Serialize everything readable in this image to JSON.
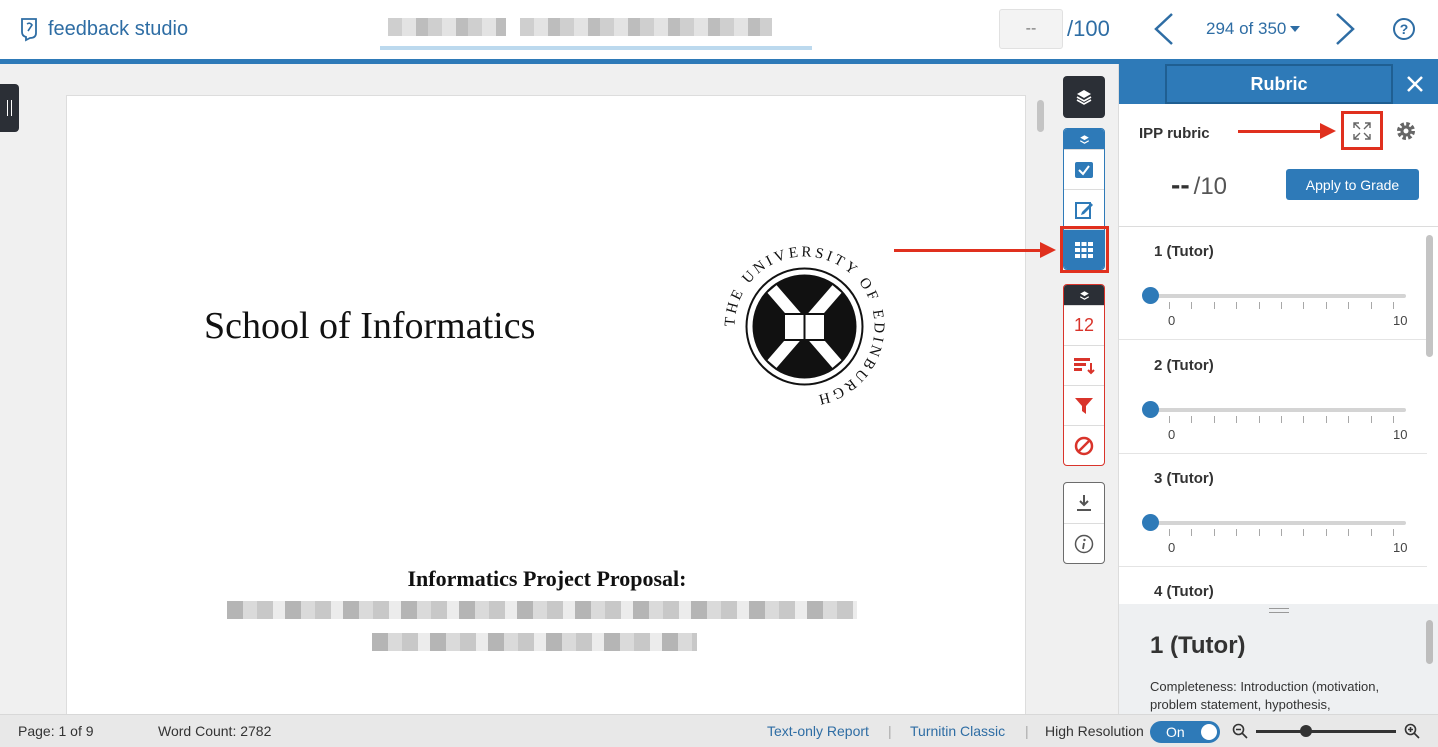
{
  "header": {
    "app_title": "feedback studio",
    "grade_value": "--",
    "grade_max": "/100",
    "page_counter": "294 of 350"
  },
  "document": {
    "title": "School of Informatics",
    "crest_text": "THE UNIVERSITY OF EDINBURGH",
    "subtitle": "Informatics Project Proposal:"
  },
  "tools": {
    "match_count": "12"
  },
  "rubric": {
    "tab_label": "Rubric",
    "name": "IPP rubric",
    "score_value": "--",
    "score_max": "/10",
    "apply_label": "Apply to Grade",
    "criteria": [
      {
        "label": "1 (Tutor)",
        "min": "0",
        "max": "10",
        "value": 0
      },
      {
        "label": "2 (Tutor)",
        "min": "0",
        "max": "10",
        "value": 0
      },
      {
        "label": "3 (Tutor)",
        "min": "0",
        "max": "10",
        "value": 0
      },
      {
        "label": "4 (Tutor)"
      }
    ],
    "detail": {
      "title": "1 (Tutor)",
      "text": "Completeness: Introduction (motivation, problem statement, hypothesis,"
    }
  },
  "footer": {
    "page": "Page: 1 of 9",
    "word_count": "Word Count: 2782",
    "text_only_report": "Text-only Report",
    "separator": "|",
    "turnitin_classic": "Turnitin Classic",
    "high_resolution": "High Resolution",
    "toggle_state": "On"
  },
  "colors": {
    "brand": "#2e7ab8",
    "annotation": "#e0301e",
    "tool_red": "#d9342b"
  }
}
